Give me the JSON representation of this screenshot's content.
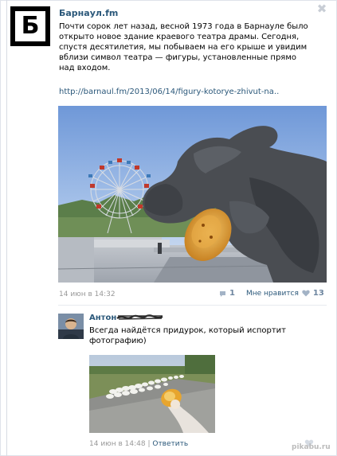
{
  "post": {
    "avatar_letter": "Б",
    "author": "Барнаул.fm",
    "text": "Почти сорок лет назад, весной 1973 года в Барнауле было открыто новое здание краевого театра драмы. Сегодня, спустя десятилетия, мы побываем на его крыше и увидим вблизи символ театра — фигуры, установленные прямо над входом.",
    "link": "http://barnaul.fm/2013/06/14/figury-kotorye-zhivut-na..",
    "date": "14 июн в 14:32",
    "repost_count": "1",
    "like_label": "Мне нравится",
    "like_count": "13",
    "close_glyph": "✖"
  },
  "comment": {
    "author": "Антон",
    "text": "Всегда найдётся придурок, который испортит фотографию)",
    "date": "14 июн в 14:48",
    "separator": " | ",
    "reply_label": "Ответить"
  },
  "watermark": "pikabu.ru",
  "colors": {
    "link": "#2b587a",
    "meta": "#999999",
    "count": "#6e86a0"
  }
}
